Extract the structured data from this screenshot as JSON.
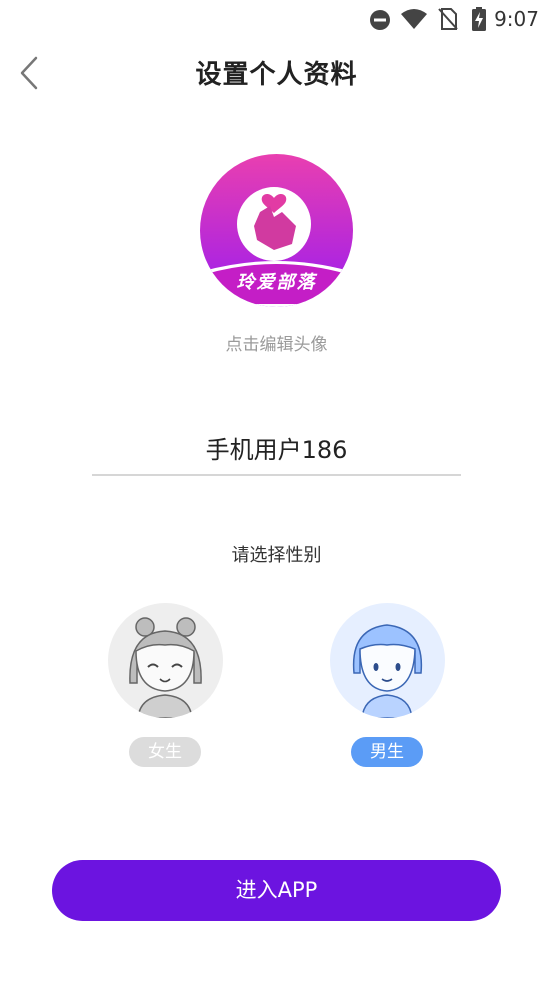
{
  "status_bar": {
    "time": "9:07",
    "icons": [
      "dnd-icon",
      "wifi-icon",
      "no-sim-icon",
      "battery-charging-icon"
    ]
  },
  "header": {
    "back_icon": "chevron-left-icon",
    "title": "设置个人资料"
  },
  "profile": {
    "avatar_logo_text": "玲爱部落",
    "avatar_hint": "点击编辑头像",
    "nickname_value": "手机用户186"
  },
  "gender": {
    "prompt": "请选择性别",
    "options": [
      {
        "label": "女生",
        "selected": false
      },
      {
        "label": "男生",
        "selected": true
      }
    ]
  },
  "actions": {
    "enter_label": "进入APP"
  },
  "colors": {
    "accent": "#6c14e0",
    "selected_tag": "#5b9cf6",
    "unselected_tag": "#dcdcdc",
    "avatar_gradient_top": "#e93fb0",
    "avatar_gradient_bottom": "#9a1cf0"
  }
}
